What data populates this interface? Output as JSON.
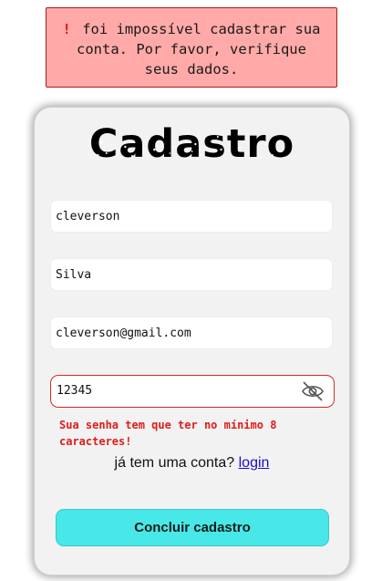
{
  "alert": {
    "icon": "!",
    "message": "foi impossível cadastrar sua conta. Por favor, verifique seus dados."
  },
  "form": {
    "title": "Cadastro",
    "first_name_value": "cleverson",
    "last_name_value": "Silva",
    "email_value": "cleverson@gmail.com",
    "password_value": "12345",
    "password_error": "Sua senha tem que ter no mínimo 8 caracteres!",
    "login_prompt": "já tem uma conta?",
    "login_link": "login",
    "submit_label": "Concluir cadastro"
  },
  "colors": {
    "alert_bg": "#ffaaa8",
    "alert_border": "#a91d1d",
    "error": "#e21b1b",
    "submit_bg": "#48e8e8",
    "link": "#1a0dcc"
  },
  "icons": {
    "password_toggle": "eye-slash-icon",
    "alert": "exclamation-icon"
  }
}
